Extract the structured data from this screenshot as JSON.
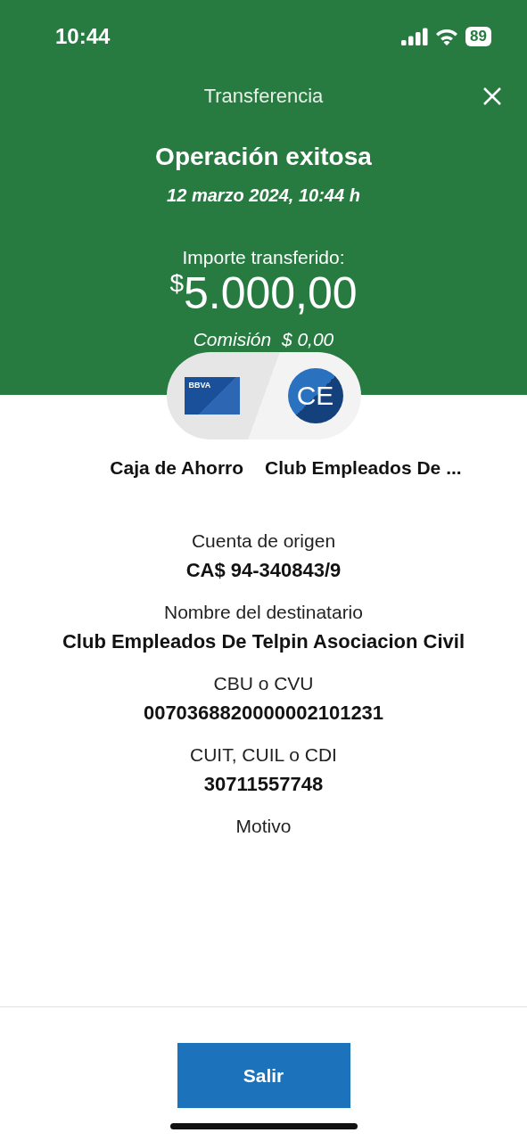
{
  "status_bar": {
    "time": "10:44",
    "battery": "89"
  },
  "header": {
    "title": "Transferencia"
  },
  "result": {
    "title": "Operación exitosa",
    "date": "12 marzo 2024, 10:44 h",
    "amount_label": "Importe transferido:",
    "currency": "$",
    "amount": "5.000,00",
    "fee": "Comisión  $ 0,00"
  },
  "transfer": {
    "card_brand": "BBVA",
    "recipient_initials": "CE",
    "origin_label": "Caja de Ahorro",
    "recipient_label": "Club Empleados De ..."
  },
  "details": [
    {
      "label": "Cuenta de origen",
      "value": "CA$ 94-340843/9"
    },
    {
      "label": "Nombre del destinatario",
      "value": "Club Empleados De Telpin Asociacion Civil"
    },
    {
      "label": "CBU o CVU",
      "value": "0070368820000002101231"
    },
    {
      "label": "CUIT, CUIL o CDI",
      "value": "30711557748"
    },
    {
      "label": "Motivo"
    }
  ],
  "buttons": [
    "Salir"
  ]
}
